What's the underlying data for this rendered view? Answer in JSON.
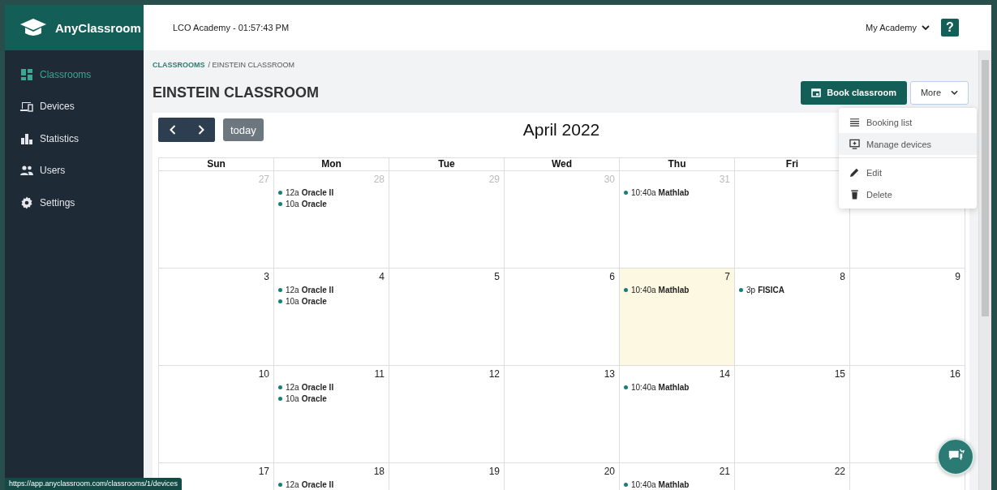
{
  "brand": {
    "name": "AnyClassroom"
  },
  "sidebar": {
    "items": [
      {
        "label": "Classrooms",
        "selected": true
      },
      {
        "label": "Devices",
        "selected": false
      },
      {
        "label": "Statistics",
        "selected": false
      },
      {
        "label": "Users",
        "selected": false
      },
      {
        "label": "Settings",
        "selected": false
      }
    ]
  },
  "header": {
    "title": "LCO Academy - 01:57:43 PM",
    "account": "My Academy",
    "help": "?"
  },
  "breadcrumb": {
    "parent": "CLASSROOMS",
    "current": "/ EINSTEIN CLASSROOM"
  },
  "page_title": "EINSTEIN CLASSROOM",
  "actions": {
    "primary": "Book classroom",
    "more": "More"
  },
  "more_menu": {
    "groups": [
      [
        {
          "label": "Booking list",
          "highlighted": false
        },
        {
          "label": "Manage devices",
          "highlighted": true
        }
      ],
      [
        {
          "label": "Edit",
          "highlighted": false
        },
        {
          "label": "Delete",
          "highlighted": false
        }
      ]
    ]
  },
  "calendar": {
    "title": "April 2022",
    "today_button": "today",
    "weekdays": [
      "Sun",
      "Mon",
      "Tue",
      "Wed",
      "Thu",
      "Fri"
    ],
    "weeks": [
      [
        {
          "date": "27",
          "other_month": true,
          "today": false
        },
        {
          "date": "28",
          "other_month": true,
          "today": false,
          "events": [
            {
              "time": "12a",
              "title": "Oracle II"
            },
            {
              "time": "10a",
              "title": "Oracle"
            }
          ]
        },
        {
          "date": "29",
          "other_month": true,
          "today": false
        },
        {
          "date": "30",
          "other_month": true,
          "today": false
        },
        {
          "date": "31",
          "other_month": true,
          "today": false,
          "events": [
            {
              "time": "10:40a",
              "title": "Mathlab"
            }
          ]
        },
        {
          "today": false
        },
        {
          "today": false
        }
      ],
      [
        {
          "date": "3",
          "today": false
        },
        {
          "date": "4",
          "today": false,
          "events": [
            {
              "time": "12a",
              "title": "Oracle II"
            },
            {
              "time": "10a",
              "title": "Oracle"
            }
          ]
        },
        {
          "date": "5",
          "today": false
        },
        {
          "date": "6",
          "today": false
        },
        {
          "date": "7",
          "today": true,
          "events": [
            {
              "time": "10:40a",
              "title": "Mathlab"
            }
          ]
        },
        {
          "date": "8",
          "today": false,
          "events": [
            {
              "time": "3p",
              "title": "FISICA"
            }
          ]
        },
        {
          "date": "9",
          "today": false
        }
      ],
      [
        {
          "date": "10",
          "today": false
        },
        {
          "date": "11",
          "today": false,
          "events": [
            {
              "time": "12a",
              "title": "Oracle II"
            },
            {
              "time": "10a",
              "title": "Oracle"
            }
          ]
        },
        {
          "date": "12",
          "today": false
        },
        {
          "date": "13",
          "today": false
        },
        {
          "date": "14",
          "today": false,
          "events": [
            {
              "time": "10:40a",
              "title": "Mathlab"
            }
          ]
        },
        {
          "date": "15",
          "today": false
        },
        {
          "date": "16",
          "today": false
        }
      ],
      [
        {
          "date": "17",
          "today": false
        },
        {
          "date": "18",
          "today": false,
          "events": [
            {
              "time": "12a",
              "title": "Oracle II"
            }
          ]
        },
        {
          "date": "19",
          "today": false
        },
        {
          "date": "20",
          "today": false
        },
        {
          "date": "21",
          "today": false,
          "events": [
            {
              "time": "10:40a",
              "title": "Mathlab"
            }
          ]
        },
        {
          "date": "22",
          "today": false
        },
        {
          "today": false
        }
      ]
    ]
  },
  "status_url": "https://app.anyclassroom.com/classrooms/1/devices"
}
